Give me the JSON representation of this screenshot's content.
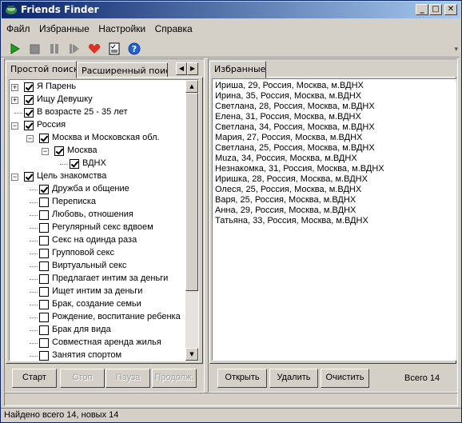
{
  "window": {
    "title": "Friends Finder",
    "controls": {
      "minimize": "_",
      "maximize": "□",
      "close": "✕"
    }
  },
  "menu": [
    "Файл",
    "Избранные",
    "Настройки",
    "Справка"
  ],
  "toolbar": {
    "icons": [
      "play-icon",
      "stop-icon",
      "pause-icon",
      "resume-icon",
      "heart-icon",
      "checklist-icon",
      "help-icon"
    ]
  },
  "search_tabs": [
    "Простой поиск",
    "Расширенный поиск"
  ],
  "tree": [
    {
      "label": "Я Парень",
      "checked": true,
      "level": 0,
      "expander": "+"
    },
    {
      "label": "Ищу Девушку",
      "checked": true,
      "level": 0,
      "expander": "+"
    },
    {
      "label": "В возрасте 25 - 35 лет",
      "checked": true,
      "level": 0,
      "expander": ""
    },
    {
      "label": "Россия",
      "checked": true,
      "level": 0,
      "expander": "−"
    },
    {
      "label": "Москва и Московская обл.",
      "checked": true,
      "level": 1,
      "expander": "−"
    },
    {
      "label": "Москва",
      "checked": true,
      "level": 2,
      "expander": "−"
    },
    {
      "label": "ВДНХ",
      "checked": true,
      "level": 3,
      "expander": ""
    },
    {
      "label": "Цель знакомства",
      "checked": true,
      "level": 0,
      "expander": "−"
    },
    {
      "label": "Дружба и общение",
      "checked": true,
      "level": 1,
      "expander": ""
    },
    {
      "label": "Переписка",
      "checked": false,
      "level": 1,
      "expander": ""
    },
    {
      "label": "Любовь, отношения",
      "checked": false,
      "level": 1,
      "expander": ""
    },
    {
      "label": "Регулярный секс вдвоем",
      "checked": false,
      "level": 1,
      "expander": ""
    },
    {
      "label": "Секс на одинда раза",
      "checked": false,
      "level": 1,
      "expander": ""
    },
    {
      "label": "Групповой секс",
      "checked": false,
      "level": 1,
      "expander": ""
    },
    {
      "label": "Виртуальный секс",
      "checked": false,
      "level": 1,
      "expander": ""
    },
    {
      "label": "Предлагает интим за деньги",
      "checked": false,
      "level": 1,
      "expander": ""
    },
    {
      "label": "Ищет интим за деньги",
      "checked": false,
      "level": 1,
      "expander": ""
    },
    {
      "label": "Брак, создание семьи",
      "checked": false,
      "level": 1,
      "expander": ""
    },
    {
      "label": "Рождение, воспитание ребенка",
      "checked": false,
      "level": 1,
      "expander": ""
    },
    {
      "label": "Брак для вида",
      "checked": false,
      "level": 1,
      "expander": ""
    },
    {
      "label": "Совместная аренда жилья",
      "checked": false,
      "level": 1,
      "expander": ""
    },
    {
      "label": "Занятия спортом",
      "checked": false,
      "level": 1,
      "expander": ""
    }
  ],
  "search_buttons": {
    "start": "Старт",
    "stop": "Стоп",
    "pause": "Пауза",
    "resume": "Продолж."
  },
  "favorites_tab": "Избранные",
  "favorites": [
    "Ириша, 29, Россия, Москва, м.ВДНХ",
    "Ирина, 35, Россия, Москва, м.ВДНХ",
    "Светлана, 28, Россия, Москва, м.ВДНХ",
    "Елена, 31, Россия, Москва, м.ВДНХ",
    "Светлана, 34, Россия, Москва, м.ВДНХ",
    "Мария, 27, Россия, Москва, м.ВДНХ",
    "Светлана, 25, Россия, Москва, м.ВДНХ",
    "Muza, 34, Россия, Москва, м.ВДНХ",
    "Незнакомка, 31, Россия, Москва, м.ВДНХ",
    "Иришка, 28, Россия, Москва, м.ВДНХ",
    "Олеся, 25, Россия, Москва, м.ВДНХ",
    "Варя, 25, Россия, Москва, м.ВДНХ",
    "Анна, 29, Россия, Москва, м.ВДНХ",
    "Татьяна, 33, Россия, Москва, м.ВДНХ"
  ],
  "favorites_buttons": {
    "open": "Открыть",
    "delete": "Удалить",
    "clear": "Очистить"
  },
  "favorites_total": "Всего 14",
  "status": "Найдено всего 14, новых 14",
  "colors": {
    "titlebar_start": "#0a246a",
    "titlebar_end": "#a6caf0",
    "face": "#d4d0c8",
    "play": "#1ca01c",
    "heart": "#e03020",
    "help": "#2060d0"
  }
}
